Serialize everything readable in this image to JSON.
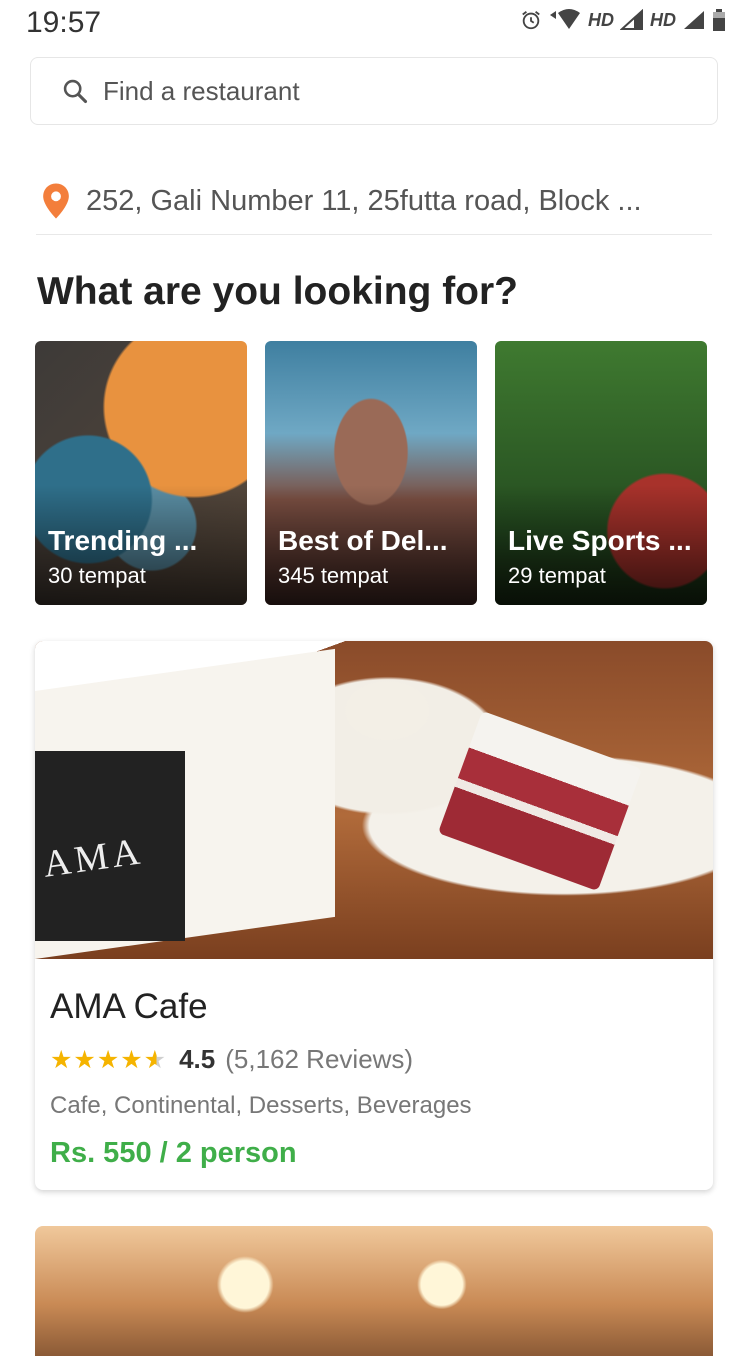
{
  "status_bar": {
    "time": "19:57",
    "network_label_1": "HD",
    "network_label_2": "HD"
  },
  "search": {
    "placeholder": "Find a restaurant",
    "icon": "search-icon"
  },
  "location": {
    "icon": "location-pin-icon",
    "address": "252, Gali Number 11, 25futta road, Block ...",
    "pin_color": "#f37e3b"
  },
  "section_title": "What are you looking for?",
  "collections": [
    {
      "name": "Trending ...",
      "count": "30 tempat"
    },
    {
      "name": "Best of Del...",
      "count": "345 tempat"
    },
    {
      "name": "Live Sports ...",
      "count": "29 tempat"
    }
  ],
  "restaurant": {
    "name": "AMA Cafe",
    "rating_stars": 4.5,
    "rating_value": "4.5",
    "reviews": "(5,162 Reviews)",
    "cuisines": "Cafe, Continental, Desserts, Beverages",
    "price": "Rs. 550 / 2 person",
    "price_color": "#3fae49",
    "star_color": "#f5b400",
    "photo_text": "AMA"
  }
}
